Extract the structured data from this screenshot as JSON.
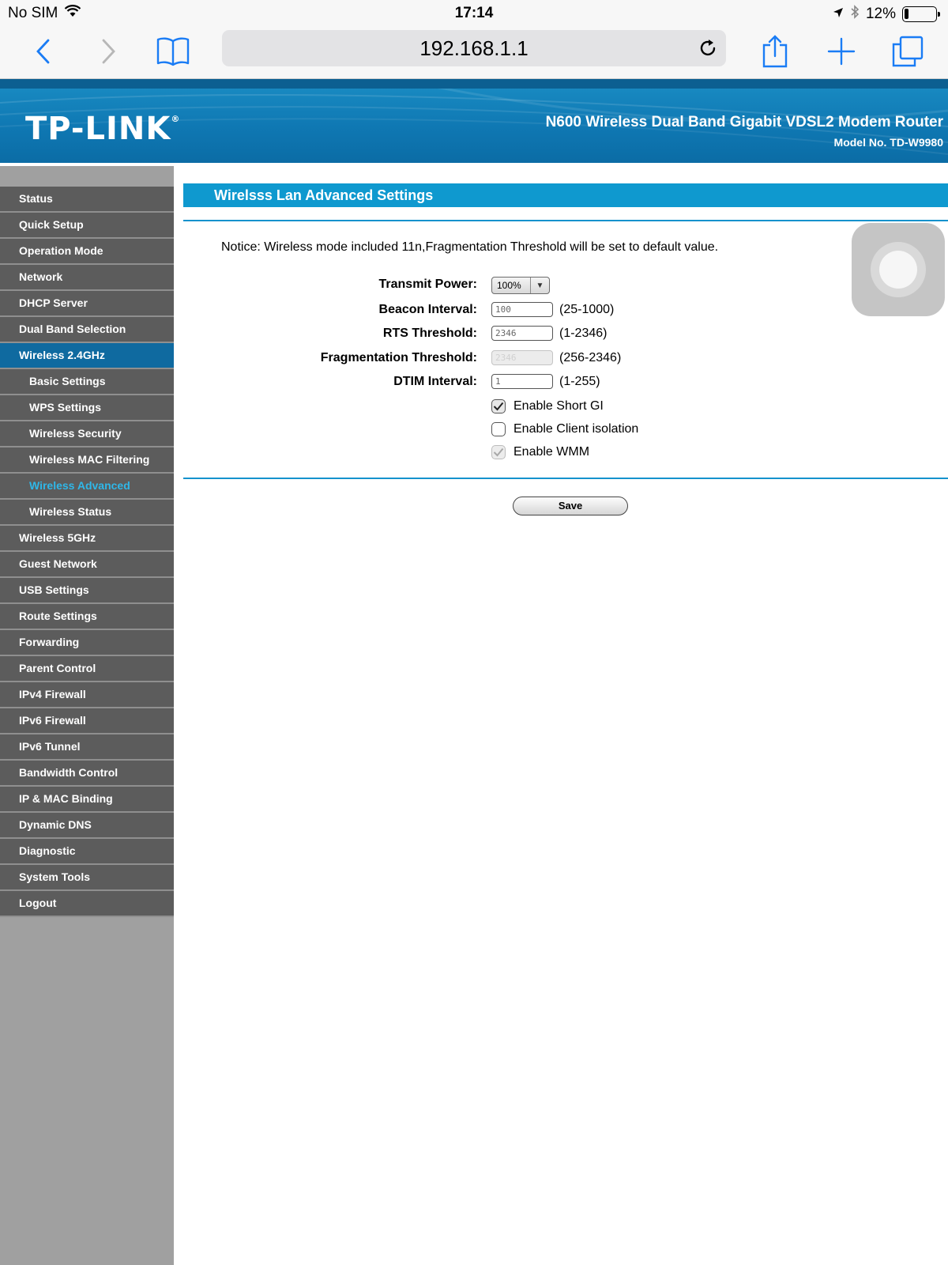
{
  "status_bar": {
    "carrier": "No SIM",
    "time": "17:14",
    "battery": "12%",
    "battery_level": 0.12
  },
  "browser": {
    "url": "192.168.1.1"
  },
  "header": {
    "brand": "TP-LINK",
    "product": "N600 Wireless Dual Band Gigabit VDSL2 Modem Router",
    "model": "Model No. TD-W9980"
  },
  "sidebar": {
    "items": [
      {
        "label": "Status",
        "type": "top"
      },
      {
        "label": "Quick Setup",
        "type": "top"
      },
      {
        "label": "Operation Mode",
        "type": "top"
      },
      {
        "label": "Network",
        "type": "top"
      },
      {
        "label": "DHCP Server",
        "type": "top"
      },
      {
        "label": "Dual Band Selection",
        "type": "top"
      },
      {
        "label": "Wireless 2.4GHz",
        "type": "active"
      },
      {
        "label": "Basic Settings",
        "type": "sub"
      },
      {
        "label": "WPS Settings",
        "type": "sub"
      },
      {
        "label": "Wireless Security",
        "type": "sub"
      },
      {
        "label": "Wireless MAC Filtering",
        "type": "sub"
      },
      {
        "label": "Wireless Advanced",
        "type": "current"
      },
      {
        "label": "Wireless Status",
        "type": "sub"
      },
      {
        "label": "Wireless 5GHz",
        "type": "top"
      },
      {
        "label": "Guest Network",
        "type": "top"
      },
      {
        "label": "USB Settings",
        "type": "top"
      },
      {
        "label": "Route Settings",
        "type": "top"
      },
      {
        "label": "Forwarding",
        "type": "top"
      },
      {
        "label": "Parent Control",
        "type": "top"
      },
      {
        "label": "IPv4 Firewall",
        "type": "top"
      },
      {
        "label": "IPv6 Firewall",
        "type": "top"
      },
      {
        "label": "IPv6 Tunnel",
        "type": "top"
      },
      {
        "label": "Bandwidth Control",
        "type": "top"
      },
      {
        "label": "IP & MAC Binding",
        "type": "top"
      },
      {
        "label": "Dynamic DNS",
        "type": "top"
      },
      {
        "label": "Diagnostic",
        "type": "top"
      },
      {
        "label": "System Tools",
        "type": "top"
      },
      {
        "label": "Logout",
        "type": "top"
      }
    ]
  },
  "main": {
    "title": "Wirelsss Lan Advanced Settings",
    "notice": "Notice: Wireless mode included 11n,Fragmentation Threshold will be set to default value.",
    "transmit_power": {
      "label": "Transmit Power:",
      "value": "100%"
    },
    "beacon_interval": {
      "label": "Beacon Interval:",
      "value": "100",
      "range": "(25-1000)"
    },
    "rts_threshold": {
      "label": "RTS Threshold:",
      "value": "2346",
      "range": "(1-2346)"
    },
    "fragmentation_threshold": {
      "label": "Fragmentation Threshold:",
      "value": "2346",
      "range": "(256-2346)"
    },
    "dtim_interval": {
      "label": "DTIM Interval:",
      "value": "1",
      "range": "(1-255)"
    },
    "short_gi": {
      "label": "Enable Short GI",
      "checked": true
    },
    "client_isolation": {
      "label": "Enable Client isolation",
      "checked": false
    },
    "wmm": {
      "label": "Enable WMM",
      "checked": true
    },
    "save_label": "Save"
  },
  "colors": {
    "banner": "#0f78b3",
    "title_bar": "#0f99cf",
    "nav_bg": "#5c5c5c",
    "nav_active": "#0f6aa0",
    "nav_current_text": "#2fb7e8"
  }
}
